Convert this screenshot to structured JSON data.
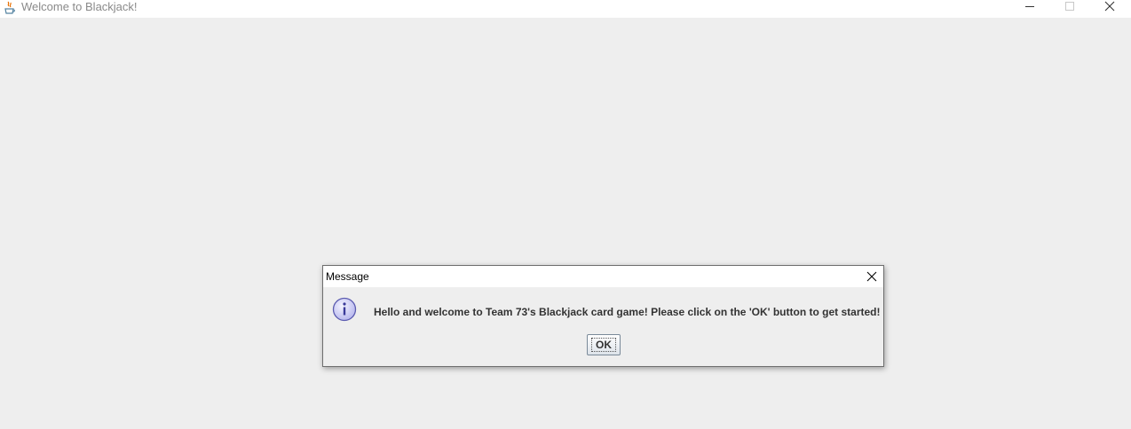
{
  "window": {
    "title": "Welcome to Blackjack!",
    "icon": "java-icon",
    "controls": [
      "minimize-icon",
      "maximize-icon",
      "close-icon"
    ]
  },
  "dialog": {
    "title": "Message",
    "icon": "info-icon",
    "message": "Hello and welcome to Team 73's Blackjack card game! Please click on the 'OK' button to get started!",
    "ok_label": "OK"
  },
  "colors": {
    "background": "#eeeeee",
    "titlebar": "#ffffff",
    "info_icon_fill": "#d6d6f5",
    "info_icon_stroke": "#5b5bb0"
  }
}
